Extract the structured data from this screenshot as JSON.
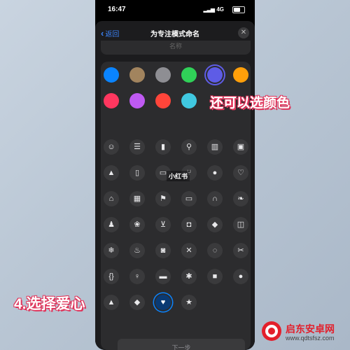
{
  "status_bar": {
    "time": "16:47",
    "network": "4G"
  },
  "nav": {
    "back_label": "返回",
    "title": "为专注模式命名",
    "close_symbol": "✕"
  },
  "name_field": {
    "placeholder": "名称"
  },
  "colors": [
    {
      "name": "blue",
      "hex": "#0a84ff",
      "selected": false
    },
    {
      "name": "brown",
      "hex": "#a2845e",
      "selected": false
    },
    {
      "name": "gray",
      "hex": "#8e8e93",
      "selected": false
    },
    {
      "name": "green",
      "hex": "#30d158",
      "selected": false
    },
    {
      "name": "indigo",
      "hex": "#5e5ce6",
      "selected": true
    },
    {
      "name": "orange",
      "hex": "#ff9f0a",
      "selected": false
    },
    {
      "name": "pink",
      "hex": "#ff375f",
      "selected": false
    },
    {
      "name": "purple",
      "hex": "#bf5af2",
      "selected": false
    },
    {
      "name": "red",
      "hex": "#ff453a",
      "selected": false
    },
    {
      "name": "teal",
      "hex": "#40c8e0",
      "selected": false
    }
  ],
  "icons": [
    {
      "name": "smiley-icon",
      "glyph": "☺"
    },
    {
      "name": "list-icon",
      "glyph": "☰"
    },
    {
      "name": "bookmark-icon",
      "glyph": "▮"
    },
    {
      "name": "pin-icon",
      "glyph": "⚲"
    },
    {
      "name": "books-icon",
      "glyph": "▥"
    },
    {
      "name": "gift-icon",
      "glyph": "▣"
    },
    {
      "name": "graduation-cap-icon",
      "glyph": "▲"
    },
    {
      "name": "document-icon",
      "glyph": "▯"
    },
    {
      "name": "credit-card-icon",
      "glyph": "▭"
    },
    {
      "name": "fork-knife-icon",
      "glyph": "⑂"
    },
    {
      "name": "pills-icon",
      "glyph": "●"
    },
    {
      "name": "stethoscope-icon",
      "glyph": "♡"
    },
    {
      "name": "house-icon",
      "glyph": "⌂"
    },
    {
      "name": "building-icon",
      "glyph": "▦"
    },
    {
      "name": "bank-icon",
      "glyph": "⚑"
    },
    {
      "name": "tv-icon",
      "glyph": "▭"
    },
    {
      "name": "headphones-icon",
      "glyph": "∩"
    },
    {
      "name": "leaf-icon",
      "glyph": "❧"
    },
    {
      "name": "person-icon",
      "glyph": "♟"
    },
    {
      "name": "paw-icon",
      "glyph": "❀"
    },
    {
      "name": "cart-icon",
      "glyph": "⊻"
    },
    {
      "name": "bag-icon",
      "glyph": "◘"
    },
    {
      "name": "box-icon",
      "glyph": "◆"
    },
    {
      "name": "train-icon",
      "glyph": "◫"
    },
    {
      "name": "snowflake-icon",
      "glyph": "❄"
    },
    {
      "name": "flame-icon",
      "glyph": "♨"
    },
    {
      "name": "briefcase-icon",
      "glyph": "◙"
    },
    {
      "name": "tools-icon",
      "glyph": "✕"
    },
    {
      "name": "game-controller-icon",
      "glyph": "◌"
    },
    {
      "name": "scissors-icon",
      "glyph": "✂"
    },
    {
      "name": "braces-icon",
      "glyph": "{}"
    },
    {
      "name": "lightbulb-icon",
      "glyph": "♀"
    },
    {
      "name": "chat-bubble-icon",
      "glyph": "▬"
    },
    {
      "name": "asterisk-icon",
      "glyph": "✱"
    },
    {
      "name": "square-icon",
      "glyph": "■"
    },
    {
      "name": "circle-icon",
      "glyph": "●"
    },
    {
      "name": "triangle-icon",
      "glyph": "▲"
    },
    {
      "name": "diamond-icon",
      "glyph": "◆"
    },
    {
      "name": "heart-icon",
      "glyph": "♥",
      "selected": true
    },
    {
      "name": "star-icon",
      "glyph": "★"
    }
  ],
  "next_button": {
    "label": "下一步"
  },
  "annotations": {
    "color_hint": "还可以选颜色",
    "step_hint": "4.选择爱心"
  },
  "watermark": {
    "xhs": "小红书",
    "site_name": "启东安卓网",
    "site_url": "www.qdtsfsz.com"
  }
}
